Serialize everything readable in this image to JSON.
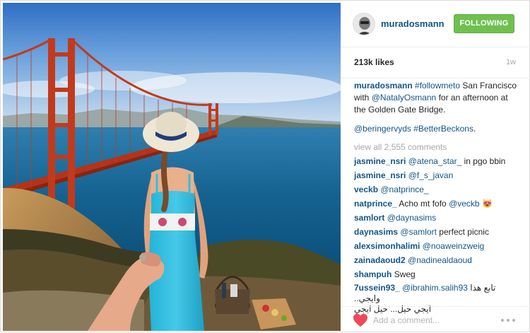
{
  "post": {
    "username": "muradosmann",
    "follow_label": "FOLLOWING",
    "likes": "213k likes",
    "time": "1w",
    "caption": {
      "username": "muradosmann",
      "hashtag": "#followmeto",
      "text1": "San Francisco with",
      "mention": "@NatalyOsmann",
      "text2": "for an afternoon at the Golden Gate Bridge."
    },
    "caption_line2": {
      "mention": "@beringervyds",
      "hashtag": "#BetterBeckons",
      "end": "."
    },
    "view_all": "view all 2,555 comments",
    "comments": [
      {
        "user": "jasmine_nsri",
        "mention": "@atena_star_",
        "text": "in pgo bbin"
      },
      {
        "user": "jasmine_nsri",
        "mention": "@f_s_javan",
        "text": ""
      },
      {
        "user": "veckb",
        "mention": "@natprince_",
        "text": ""
      },
      {
        "user": "natprince_",
        "mention": "",
        "text": "Acho mt fofo",
        "mention2": "@veckb",
        "emoji": "😻"
      },
      {
        "user": "samlort",
        "mention": "@daynasims",
        "text": ""
      },
      {
        "user": "daynasims",
        "mention": "@samlort",
        "text": "perfect picnic"
      },
      {
        "user": "alexsimonhalimi",
        "mention": "@noaweinzweig",
        "text": ""
      },
      {
        "user": "zainadaoud2",
        "mention": "@nadinealdaoud",
        "text": ""
      },
      {
        "user": "shampuh",
        "mention": "",
        "text": "Sweg"
      },
      {
        "user": "7ussein93_",
        "mention": "@ibrahim.salih93",
        "text": "تابع هذا وايجي..",
        "text2": "ايجي حيل... حيل ايجي"
      }
    ],
    "add_comment_placeholder": "Add a comment..."
  },
  "icons": {
    "heart": "heart-icon",
    "more": "more-options-icon",
    "avatar": "avatar"
  },
  "colors": {
    "username_link": "#125688",
    "follow_button": "#70c050",
    "heart": "#ed4956",
    "muted": "#a5a7aa"
  }
}
